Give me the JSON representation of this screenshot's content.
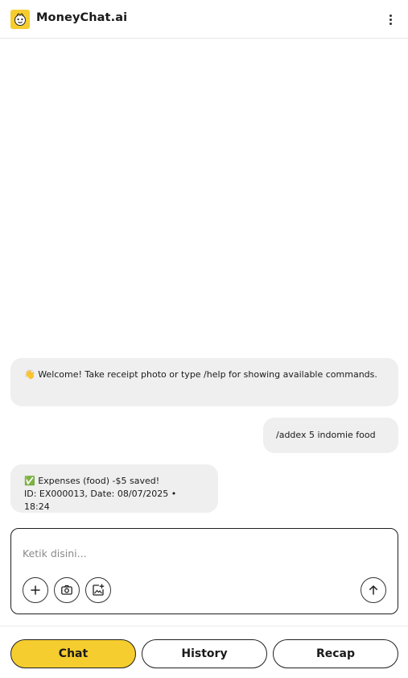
{
  "app": {
    "title": "MoneyChat.ai"
  },
  "header": {
    "menu_icon": "kebab-menu-icon"
  },
  "messages": [
    {
      "from": "bot",
      "emoji": "👋",
      "text": "Welcome! Take receipt photo or type /help for showing available commands."
    },
    {
      "from": "user",
      "text": "/addex 5 indomie food"
    },
    {
      "from": "bot",
      "emoji": "✅",
      "line1": "Expenses (food) -$5 saved!",
      "line2": "ID: EX000013, Date: 08/07/2025 • 18:24"
    }
  ],
  "composer": {
    "placeholder": "Ketik disini...",
    "value": "",
    "icons": [
      "plus-icon",
      "camera-icon",
      "add-image-icon",
      "send-arrow-icon"
    ]
  },
  "nav": {
    "chat": "Chat",
    "history": "History",
    "recap": "Recap",
    "active": "chat"
  },
  "colors": {
    "accent": "#f5cd2e",
    "bubble": "#efefef",
    "border": "#1f1f1f"
  }
}
